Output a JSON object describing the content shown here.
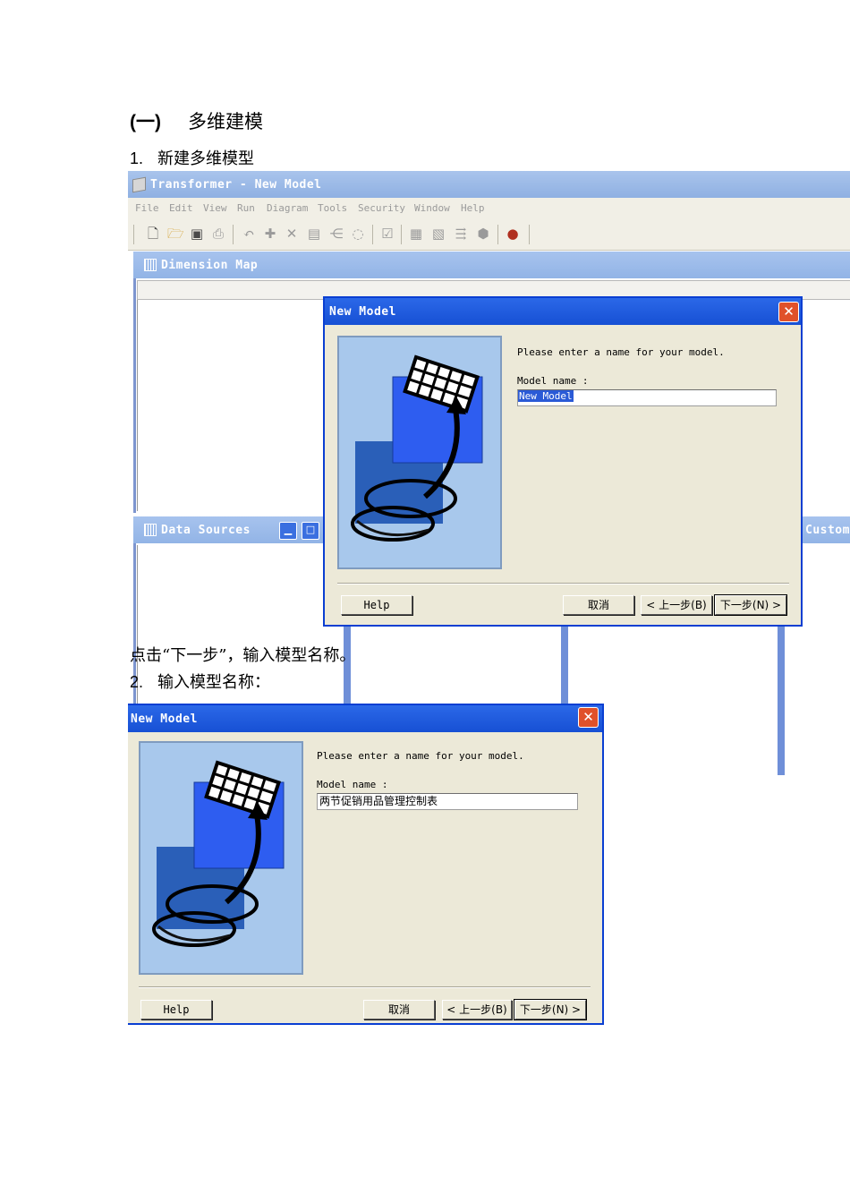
{
  "doc": {
    "heading_num": "(一)",
    "heading_text": "多维建模",
    "step1_num": "1.",
    "step1_text": "新建多维模型",
    "caption": "点击“下一步”，输入模型名称。",
    "step2_num": "2.",
    "step2_text": "输入模型名称："
  },
  "app": {
    "title": "Transformer - New Model",
    "menu": [
      "File",
      "Edit",
      "View",
      "Run",
      "Diagram",
      "Tools",
      "Security",
      "Window",
      "Help"
    ],
    "toolbar_icons": [
      "new-icon",
      "open-icon",
      "save-icon",
      "print-icon",
      "undo-icon",
      "add-icon",
      "delete-icon",
      "properties-icon",
      "dimension-icon",
      "generate-icon",
      "check-icon",
      "cube-icon",
      "powercube-icon",
      "category-icon",
      "package-icon",
      "ball-icon"
    ]
  },
  "panels": {
    "dimension_map": "Dimension Map",
    "data_sources": "Data Sources",
    "custom_views": "Custom"
  },
  "dialog1": {
    "title": "New Model",
    "prompt": "Please enter a name for your model.",
    "field_label": "Model name :",
    "field_value": "New Model",
    "help": "Help",
    "cancel": "取消",
    "back": "< 上一步(B)",
    "next": "下一步(N) >"
  },
  "dialog2": {
    "title": "New Model",
    "prompt": "Please enter a name for your model.",
    "field_label": "Model name :",
    "field_value": "两节促销用品管理控制表",
    "help": "Help",
    "cancel": "取消",
    "back": "< 上一步(B)",
    "next": "下一步(N) >"
  }
}
